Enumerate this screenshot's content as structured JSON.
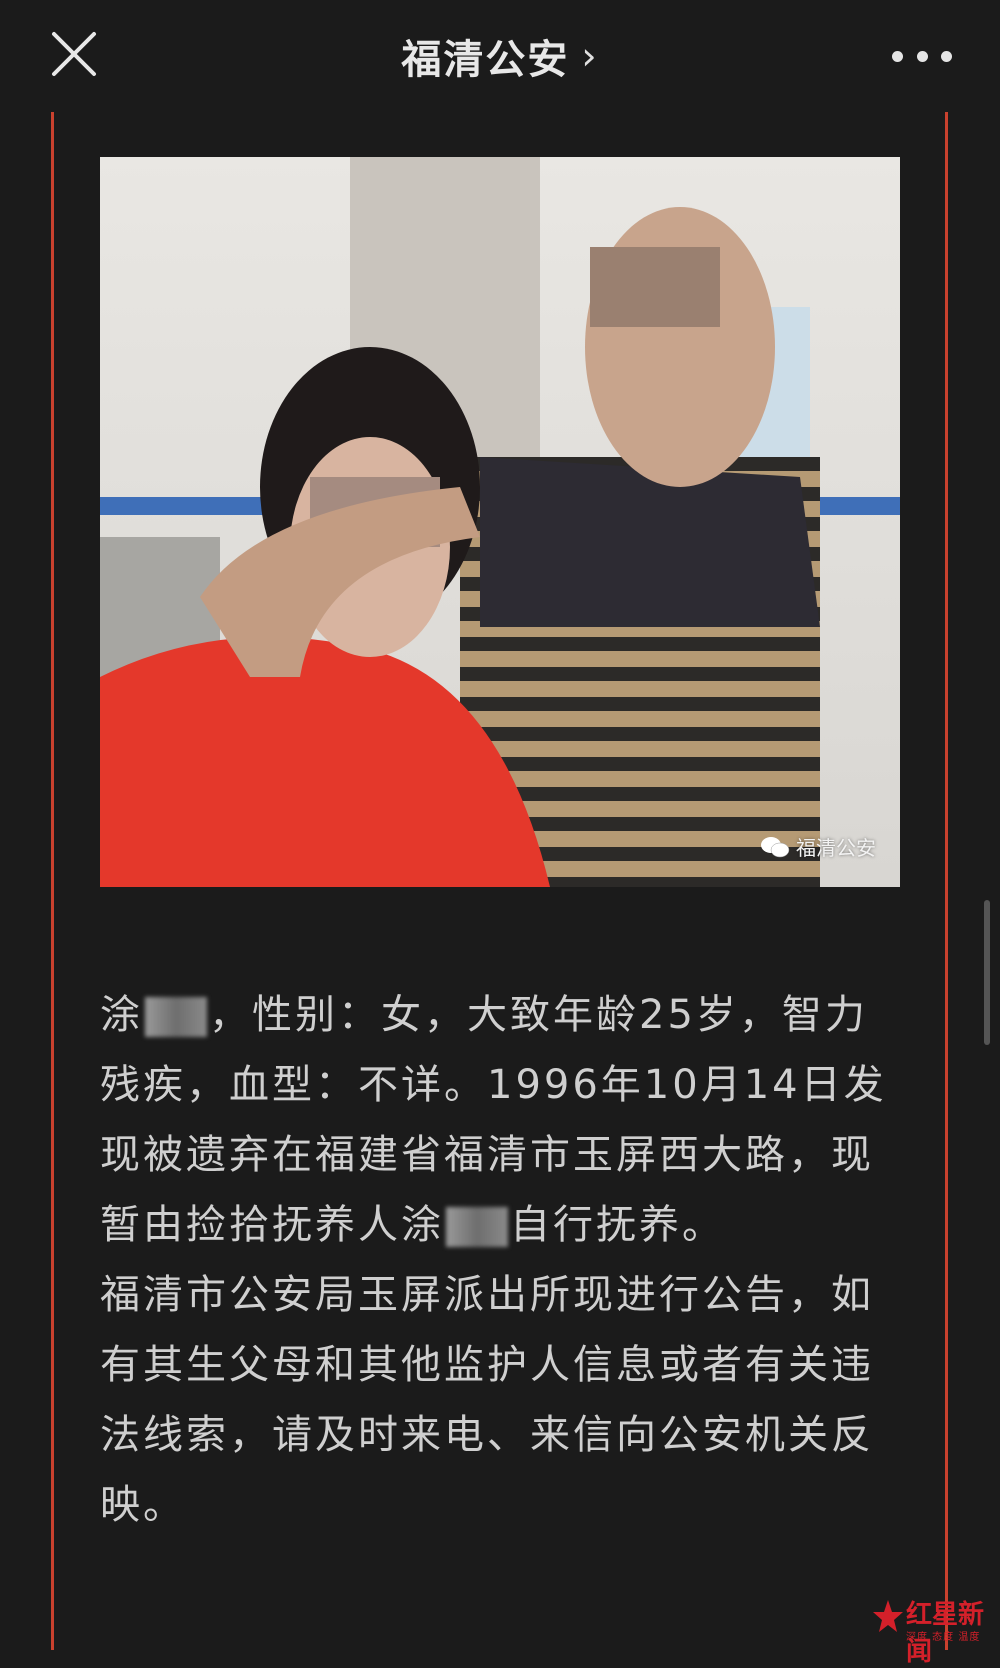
{
  "header": {
    "title": "福清公安",
    "chevron": "›",
    "close_icon": "close-icon",
    "more_icon": "more-icon"
  },
  "photo": {
    "watermark": "福清公安"
  },
  "article": {
    "paragraph1_parts": [
      "涂",
      "，性别：女，大致年龄25岁，智力残疾，血型：不详。1996年10月14日发现被遗弃在福建省福清市玉屏西大路，现暂由捡拾抚养人涂",
      "自行抚养。"
    ],
    "paragraph2": "福清市公安局玉屏派出所现进行公告，如有其生父母和其他监护人信息或者有关违法线索，请及时来电、来信向公安机关反映。"
  },
  "logo": {
    "text": "红星新闻",
    "sub": "深度 态度 温度"
  },
  "colors": {
    "background": "#1b1b1b",
    "frame_line": "#c9412e",
    "text": "#cfcfcf",
    "logo": "#d4202a"
  }
}
